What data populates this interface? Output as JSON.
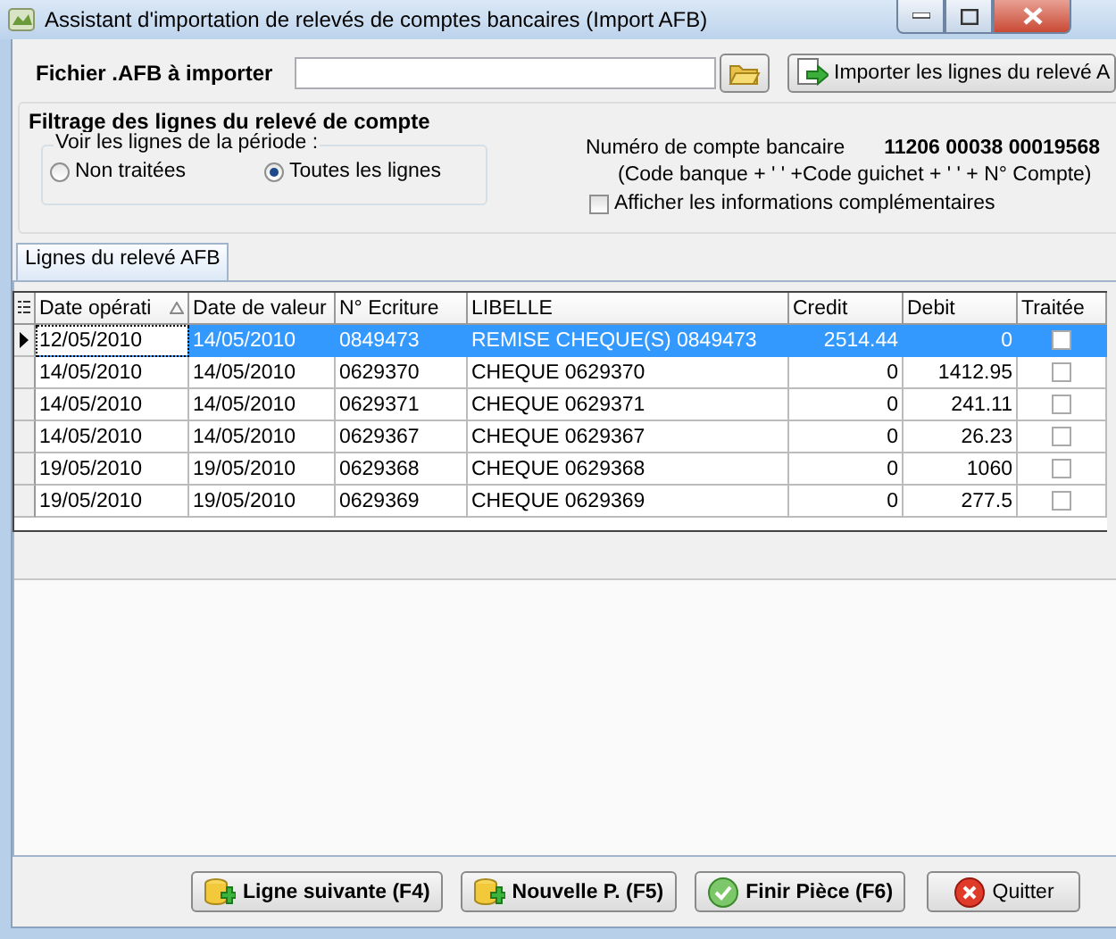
{
  "window": {
    "title": "Assistant d'importation de relevés de comptes bancaires (Import AFB)"
  },
  "file": {
    "label": "Fichier .AFB à importer",
    "import_button": "Importer les lignes du relevé A"
  },
  "filter": {
    "title": "Filtrage des lignes du relevé de compte",
    "period_label": "Voir les lignes de la période :",
    "radios": [
      {
        "label": "Non traitées",
        "selected": false
      },
      {
        "label": "Toutes les lignes",
        "selected": true
      }
    ],
    "account_label": "Numéro de compte bancaire",
    "account_number": "11206 00038 00019568",
    "account_hint": "(Code banque + ' ' +Code guichet + ' ' + N° Compte)",
    "show_more": {
      "label": "Afficher les informations complémentaires",
      "checked": false
    }
  },
  "tabs": [
    {
      "label": "Lignes du relevé AFB",
      "selected": true
    }
  ],
  "table": {
    "columns": [
      {
        "label": "Date opérati",
        "sorted": true
      },
      {
        "label": "Date de valeur",
        "sorted": false
      },
      {
        "label": "N° Ecriture",
        "sorted": false
      },
      {
        "label": "LIBELLE",
        "sorted": false
      },
      {
        "label": "Credit",
        "sorted": false
      },
      {
        "label": "Debit",
        "sorted": false
      },
      {
        "label": "Traitée",
        "sorted": false
      }
    ],
    "rows": [
      {
        "cells": [
          "12/05/2010",
          "14/05/2010",
          "0849473",
          "REMISE CHEQUE(S) 0849473",
          "2514.44",
          "0"
        ],
        "treated": false,
        "selected": true
      },
      {
        "cells": [
          "14/05/2010",
          "14/05/2010",
          "0629370",
          "CHEQUE 0629370",
          "0",
          "1412.95"
        ],
        "treated": false,
        "selected": false
      },
      {
        "cells": [
          "14/05/2010",
          "14/05/2010",
          "0629371",
          "CHEQUE 0629371",
          "0",
          "241.11"
        ],
        "treated": false,
        "selected": false
      },
      {
        "cells": [
          "14/05/2010",
          "14/05/2010",
          "0629367",
          "CHEQUE 0629367",
          "0",
          "26.23"
        ],
        "treated": false,
        "selected": false
      },
      {
        "cells": [
          "19/05/2010",
          "19/05/2010",
          "0629368",
          "CHEQUE 0629368",
          "0",
          "1060"
        ],
        "treated": false,
        "selected": false
      },
      {
        "cells": [
          "19/05/2010",
          "19/05/2010",
          "0629369",
          "CHEQUE 0629369",
          "0",
          "277.5"
        ],
        "treated": false,
        "selected": false
      }
    ]
  },
  "buttons": [
    {
      "label": "Ligne suivante (F4)",
      "kind": "add"
    },
    {
      "label": "Nouvelle P. (F5)",
      "kind": "add"
    },
    {
      "label": "Finir Pièce (F6)",
      "kind": "check"
    },
    {
      "label": "Quitter",
      "kind": "quit"
    }
  ]
}
